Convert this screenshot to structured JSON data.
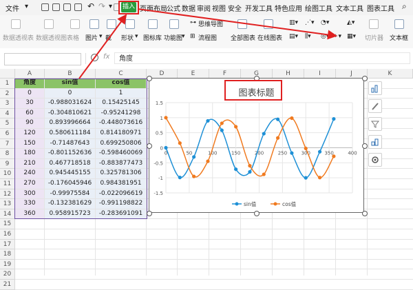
{
  "menubar": {
    "file": "文件",
    "tabs": [
      "插入",
      "页面布局",
      "公式",
      "数据",
      "审阅",
      "视图",
      "安全",
      "开发工具",
      "特色应用",
      "绘图工具",
      "文本工具",
      "图表工具"
    ],
    "active_tab": "插入"
  },
  "ribbon": {
    "pivot_table": "数据透视表",
    "pivot_chart": "数据透视图",
    "table": "表格",
    "picture": "图片",
    "screenshot": "截",
    "shapes": "形状",
    "icon_library": "图标库",
    "function_chart": "功能图",
    "mind_map": "思维导图",
    "flowchart": "流程图",
    "all_charts": "全部图表",
    "online_charts": "在线图表",
    "slicer": "切片器",
    "textbox": "文本框"
  },
  "formula_bar": {
    "fx": "fx",
    "value": "角度"
  },
  "columns": [
    "A",
    "B",
    "C",
    "D",
    "E",
    "F",
    "G",
    "H",
    "I",
    "J",
    "K"
  ],
  "rows": [
    "1",
    "2",
    "3",
    "4",
    "5",
    "6",
    "7",
    "8",
    "9",
    "10",
    "11",
    "12",
    "13",
    "14",
    "15",
    "16",
    "17",
    "18",
    "19",
    "20",
    "21"
  ],
  "table": {
    "headers": [
      "角度",
      "sin值",
      "cos值"
    ],
    "rows": [
      [
        "0",
        "0",
        "1"
      ],
      [
        "30",
        "-0.988031624",
        "0.15425145"
      ],
      [
        "60",
        "-0.304810621",
        "-0.95241298"
      ],
      [
        "90",
        "0.893996664",
        "-0.448073616"
      ],
      [
        "120",
        "0.580611184",
        "0.814180971"
      ],
      [
        "150",
        "-0.71487643",
        "0.699250806"
      ],
      [
        "180",
        "-0.801152636",
        "-0.598460069"
      ],
      [
        "210",
        "0.467718518",
        "-0.883877473"
      ],
      [
        "240",
        "0.945445155",
        "0.325781306"
      ],
      [
        "270",
        "-0.176045946",
        "0.984381951"
      ],
      [
        "300",
        "-0.99975584",
        "-0.022096619"
      ],
      [
        "330",
        "-0.132381629",
        "-0.991198822"
      ],
      [
        "360",
        "0.958915723",
        "-0.283691091"
      ]
    ]
  },
  "colors": {
    "sin": "#1e90d6",
    "cos": "#f07a1f",
    "header_green": "#8bc367",
    "annotation_red": "#e02020"
  },
  "chart_data": {
    "type": "scatter",
    "title": "图表标题",
    "x": [
      0,
      30,
      60,
      90,
      120,
      150,
      180,
      210,
      240,
      270,
      300,
      330,
      360
    ],
    "series": [
      {
        "name": "sin值",
        "values": [
          0,
          -0.988031624,
          -0.304810621,
          0.893996664,
          0.580611184,
          -0.71487643,
          -0.801152636,
          0.467718518,
          0.945445155,
          -0.176045946,
          -0.99975584,
          -0.132381629,
          0.958915723
        ]
      },
      {
        "name": "cos值",
        "values": [
          1,
          0.15425145,
          -0.95241298,
          -0.448073616,
          0.814180971,
          0.699250806,
          -0.598460069,
          -0.883877473,
          0.325781306,
          0.984381951,
          -0.022096619,
          -0.991198822,
          -0.283691091
        ]
      }
    ],
    "xlim": [
      0,
      400
    ],
    "ylim": [
      -1.5,
      1.5
    ],
    "xticks": [
      0,
      50,
      100,
      150,
      200,
      250,
      300,
      350,
      400
    ],
    "yticks": [
      -1.5,
      -1,
      -0.5,
      0,
      0.5,
      1,
      1.5
    ],
    "grid": true,
    "smooth": true,
    "legend": "bottom"
  },
  "side_tools": [
    "chart-elements-icon",
    "chart-style-icon",
    "chart-filter-icon",
    "chart-settings-icon",
    "gear-icon"
  ]
}
